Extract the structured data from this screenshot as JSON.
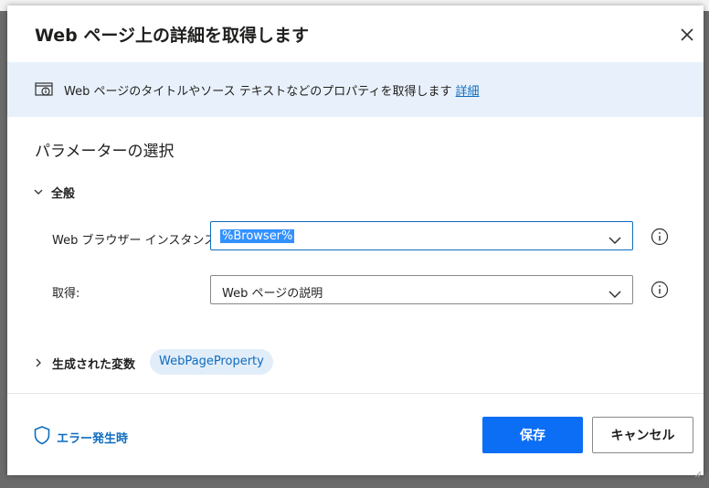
{
  "dialog": {
    "title": "Web ページ上の詳細を取得します",
    "close_icon": "close-icon"
  },
  "info": {
    "icon": "web-page-info-icon",
    "text": "Web ページのタイトルやソース テキストなどのプロパティを取得します",
    "link": "詳細"
  },
  "params": {
    "title": "パラメーターの選択",
    "group": {
      "label": "全般",
      "icon": "chevron-down-icon"
    },
    "fields": [
      {
        "label": "Web ブラウザー インスタンス:",
        "value": "%Browser%",
        "icon": "chevron-down-icon",
        "help_icon": "info-circle-icon"
      },
      {
        "label": "取得:",
        "value": "Web ページの説明",
        "icon": "chevron-down-icon",
        "help_icon": "info-circle-icon"
      }
    ]
  },
  "variables": {
    "label": "生成された変数",
    "icon": "chevron-right-icon",
    "chip": "WebPageProperty"
  },
  "footer": {
    "error_label": "エラー発生時",
    "error_icon": "shield-icon",
    "save_label": "保存",
    "cancel_label": "キャンセル"
  },
  "colors": {
    "accent": "#0f6cbd",
    "primary_button": "#0b6ef5",
    "info_bar": "#e8f1fb"
  }
}
